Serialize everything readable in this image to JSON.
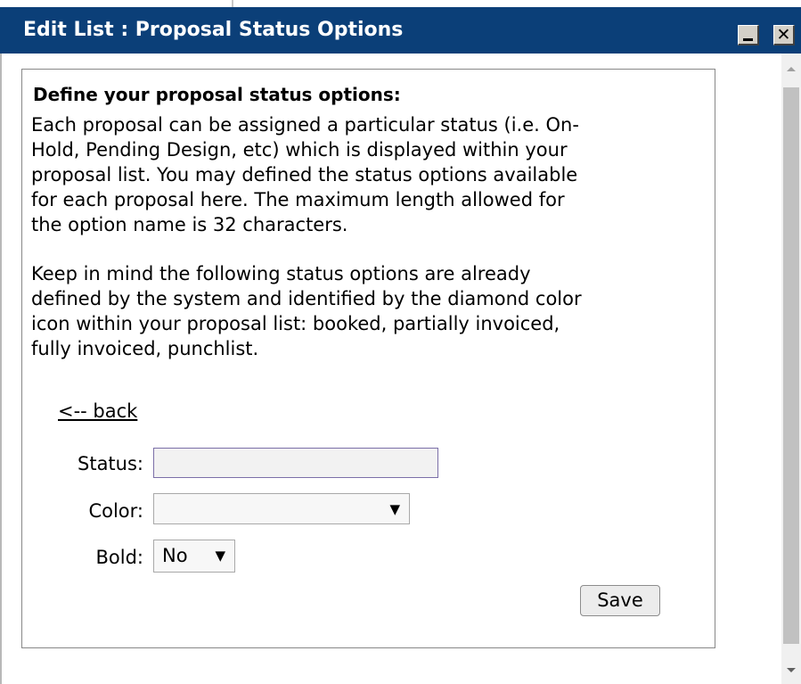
{
  "window": {
    "title": "Edit List : Proposal Status Options",
    "minimize_symbol": "",
    "close_symbol": "✕"
  },
  "content": {
    "heading": "Define your proposal status options:",
    "paragraph1": "Each proposal can be assigned a particular status (i.e. On-\nHold, Pending Design, etc) which is displayed within your\nproposal list. You may defined the status options available\nfor each proposal here. The maximum length allowed for\nthe option name is 32 characters.",
    "paragraph2": "Keep in mind the following status options are already\ndefined by the system and identified by the diamond color\nicon within your proposal list: booked, partially invoiced,\nfully invoiced, punchlist.",
    "back_link": "<-- back"
  },
  "form": {
    "status_label": "Status:",
    "status_value": "",
    "color_label": "Color:",
    "color_value": "",
    "bold_label": "Bold:",
    "bold_value": "No",
    "dropdown_arrow": "▼",
    "save_label": "Save"
  },
  "colors": {
    "title_bar": "#0b3f78",
    "title_text": "#ffffff",
    "input_border": "#7b6fa8",
    "scrollbar_thumb": "#c1c1c1"
  },
  "icons": {
    "minimize": "minimize-icon",
    "close": "close-icon",
    "dropdown": "chevron-down-icon",
    "scroll_up": "scroll-up-arrow-icon",
    "scroll_down": "scroll-down-arrow-icon"
  }
}
